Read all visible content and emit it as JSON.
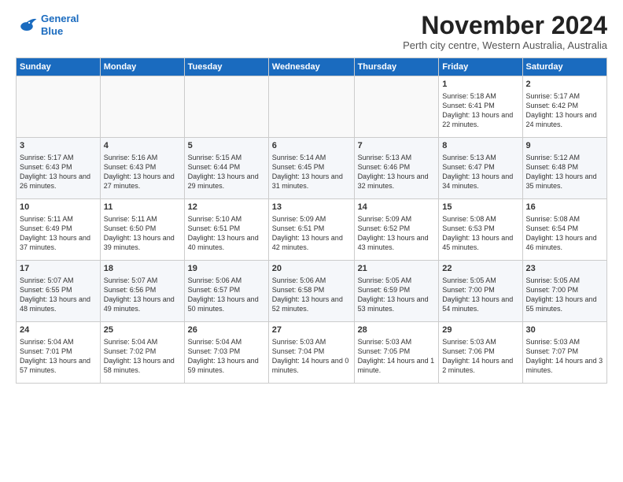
{
  "logo": {
    "line1": "General",
    "line2": "Blue"
  },
  "title": "November 2024",
  "subtitle": "Perth city centre, Western Australia, Australia",
  "days_header": [
    "Sunday",
    "Monday",
    "Tuesday",
    "Wednesday",
    "Thursday",
    "Friday",
    "Saturday"
  ],
  "weeks": [
    [
      {
        "day": "",
        "info": ""
      },
      {
        "day": "",
        "info": ""
      },
      {
        "day": "",
        "info": ""
      },
      {
        "day": "",
        "info": ""
      },
      {
        "day": "",
        "info": ""
      },
      {
        "day": "1",
        "info": "Sunrise: 5:18 AM\nSunset: 6:41 PM\nDaylight: 13 hours\nand 22 minutes."
      },
      {
        "day": "2",
        "info": "Sunrise: 5:17 AM\nSunset: 6:42 PM\nDaylight: 13 hours\nand 24 minutes."
      }
    ],
    [
      {
        "day": "3",
        "info": "Sunrise: 5:17 AM\nSunset: 6:43 PM\nDaylight: 13 hours\nand 26 minutes."
      },
      {
        "day": "4",
        "info": "Sunrise: 5:16 AM\nSunset: 6:43 PM\nDaylight: 13 hours\nand 27 minutes."
      },
      {
        "day": "5",
        "info": "Sunrise: 5:15 AM\nSunset: 6:44 PM\nDaylight: 13 hours\nand 29 minutes."
      },
      {
        "day": "6",
        "info": "Sunrise: 5:14 AM\nSunset: 6:45 PM\nDaylight: 13 hours\nand 31 minutes."
      },
      {
        "day": "7",
        "info": "Sunrise: 5:13 AM\nSunset: 6:46 PM\nDaylight: 13 hours\nand 32 minutes."
      },
      {
        "day": "8",
        "info": "Sunrise: 5:13 AM\nSunset: 6:47 PM\nDaylight: 13 hours\nand 34 minutes."
      },
      {
        "day": "9",
        "info": "Sunrise: 5:12 AM\nSunset: 6:48 PM\nDaylight: 13 hours\nand 35 minutes."
      }
    ],
    [
      {
        "day": "10",
        "info": "Sunrise: 5:11 AM\nSunset: 6:49 PM\nDaylight: 13 hours\nand 37 minutes."
      },
      {
        "day": "11",
        "info": "Sunrise: 5:11 AM\nSunset: 6:50 PM\nDaylight: 13 hours\nand 39 minutes."
      },
      {
        "day": "12",
        "info": "Sunrise: 5:10 AM\nSunset: 6:51 PM\nDaylight: 13 hours\nand 40 minutes."
      },
      {
        "day": "13",
        "info": "Sunrise: 5:09 AM\nSunset: 6:51 PM\nDaylight: 13 hours\nand 42 minutes."
      },
      {
        "day": "14",
        "info": "Sunrise: 5:09 AM\nSunset: 6:52 PM\nDaylight: 13 hours\nand 43 minutes."
      },
      {
        "day": "15",
        "info": "Sunrise: 5:08 AM\nSunset: 6:53 PM\nDaylight: 13 hours\nand 45 minutes."
      },
      {
        "day": "16",
        "info": "Sunrise: 5:08 AM\nSunset: 6:54 PM\nDaylight: 13 hours\nand 46 minutes."
      }
    ],
    [
      {
        "day": "17",
        "info": "Sunrise: 5:07 AM\nSunset: 6:55 PM\nDaylight: 13 hours\nand 48 minutes."
      },
      {
        "day": "18",
        "info": "Sunrise: 5:07 AM\nSunset: 6:56 PM\nDaylight: 13 hours\nand 49 minutes."
      },
      {
        "day": "19",
        "info": "Sunrise: 5:06 AM\nSunset: 6:57 PM\nDaylight: 13 hours\nand 50 minutes."
      },
      {
        "day": "20",
        "info": "Sunrise: 5:06 AM\nSunset: 6:58 PM\nDaylight: 13 hours\nand 52 minutes."
      },
      {
        "day": "21",
        "info": "Sunrise: 5:05 AM\nSunset: 6:59 PM\nDaylight: 13 hours\nand 53 minutes."
      },
      {
        "day": "22",
        "info": "Sunrise: 5:05 AM\nSunset: 7:00 PM\nDaylight: 13 hours\nand 54 minutes."
      },
      {
        "day": "23",
        "info": "Sunrise: 5:05 AM\nSunset: 7:00 PM\nDaylight: 13 hours\nand 55 minutes."
      }
    ],
    [
      {
        "day": "24",
        "info": "Sunrise: 5:04 AM\nSunset: 7:01 PM\nDaylight: 13 hours\nand 57 minutes."
      },
      {
        "day": "25",
        "info": "Sunrise: 5:04 AM\nSunset: 7:02 PM\nDaylight: 13 hours\nand 58 minutes."
      },
      {
        "day": "26",
        "info": "Sunrise: 5:04 AM\nSunset: 7:03 PM\nDaylight: 13 hours\nand 59 minutes."
      },
      {
        "day": "27",
        "info": "Sunrise: 5:03 AM\nSunset: 7:04 PM\nDaylight: 14 hours\nand 0 minutes."
      },
      {
        "day": "28",
        "info": "Sunrise: 5:03 AM\nSunset: 7:05 PM\nDaylight: 14 hours\nand 1 minute."
      },
      {
        "day": "29",
        "info": "Sunrise: 5:03 AM\nSunset: 7:06 PM\nDaylight: 14 hours\nand 2 minutes."
      },
      {
        "day": "30",
        "info": "Sunrise: 5:03 AM\nSunset: 7:07 PM\nDaylight: 14 hours\nand 3 minutes."
      }
    ]
  ]
}
